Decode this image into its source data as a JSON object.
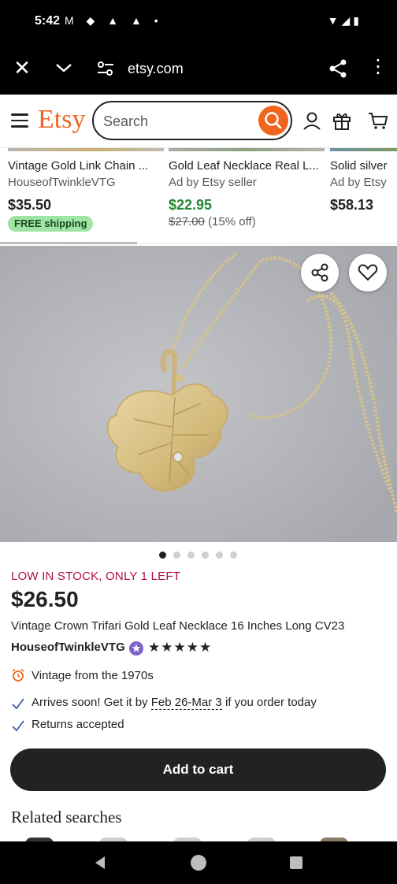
{
  "status_bar": {
    "time": "5:42",
    "left_icons": "M ◆ ▲ ▲ •",
    "right_icons": "▼◢▮"
  },
  "browser": {
    "url": "etsy.com"
  },
  "header": {
    "logo": "Etsy",
    "search_placeholder": "Search"
  },
  "carousel": [
    {
      "title": "Vintage Gold Link Chain ...",
      "subtitle": "HouseofTwinkleVTG",
      "price": "$35.50",
      "badge": "FREE shipping"
    },
    {
      "title": "Gold Leaf Necklace Real L...",
      "subtitle": "Ad by Etsy seller",
      "price": "$22.95",
      "original_price": "$27.00",
      "discount": "(15% off)"
    },
    {
      "title": "Solid silver",
      "subtitle": "Ad by Etsy",
      "price": "$58.13"
    }
  ],
  "product": {
    "stock_notice": "LOW IN STOCK, ONLY 1 LEFT",
    "price": "$26.50",
    "title": "Vintage Crown Trifari Gold Leaf Necklace 16 Inches Long CV23",
    "seller": "HouseofTwinkleVTG",
    "rating_stars": "★★★★★",
    "rating": 5,
    "image_count": 6,
    "current_image": 1,
    "features": {
      "vintage": "Vintage from the 1970s",
      "arrival_prefix": "Arrives soon! Get it by",
      "arrival_dates": "Feb 26-Mar 3",
      "arrival_suffix": "if you order today",
      "returns": "Returns accepted"
    },
    "add_to_cart": "Add to cart"
  },
  "related": {
    "heading": "Related searches"
  },
  "colors": {
    "brand": "#f1641e",
    "sale": "#258635",
    "alert": "#b1123a",
    "button": "#222222"
  }
}
